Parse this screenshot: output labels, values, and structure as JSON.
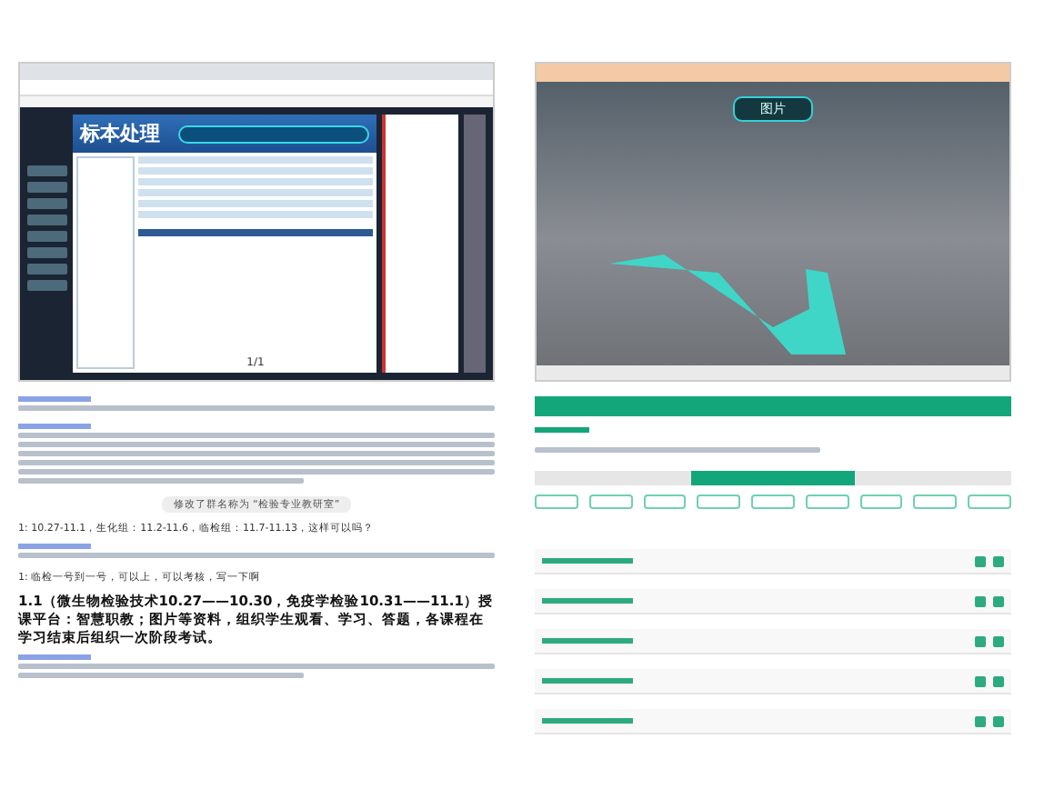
{
  "left_screenshot": {
    "app_title": "标本处理",
    "pager": "1/1"
  },
  "chat": [
    {
      "kind": "blur_line"
    },
    {
      "kind": "blur_paragraph"
    },
    {
      "kind": "notice",
      "text": "修改了群名称为 “检验专业教研室”"
    },
    {
      "kind": "text",
      "text": "1: 10.27-11.1，生化组：11.2-11.6，临检组：11.7-11.13，这样可以吗？"
    },
    {
      "kind": "blur_line"
    },
    {
      "kind": "text",
      "text": "1: 临检一号到一号，可以上，可以考核，写一下啊"
    },
    {
      "kind": "heading",
      "text": "1.1（微生物检验技术10.27——10.30，免疫学检验10.31——11.1）授课平台：智慧职教；图片等资料，组织学生观看、学习、答题，各课程在学习结束后组织一次阶段考试。"
    },
    {
      "kind": "blur_short"
    }
  ],
  "right_screenshot": {
    "scene_button": "图片"
  }
}
